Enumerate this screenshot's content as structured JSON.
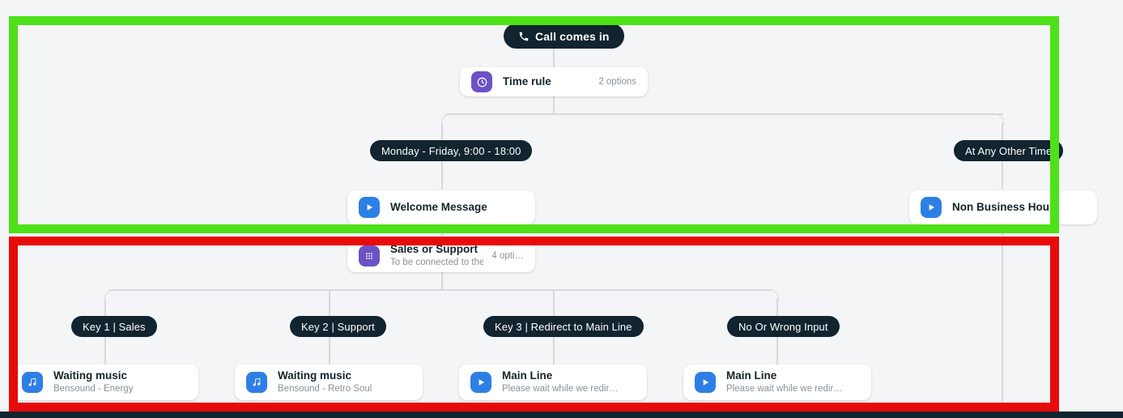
{
  "canvas": {
    "background": "#f4f5f6",
    "connector_color": "#d7d9dc"
  },
  "flow": {
    "start": {
      "label": "Call comes in",
      "icon": "phone-icon"
    },
    "time_rule": {
      "title": "Time rule",
      "meta": "2 options",
      "icon": "clock-icon",
      "icon_color": "#6d51c6"
    },
    "branches": [
      {
        "label": "Monday - Friday, 9:00 - 18:00"
      },
      {
        "label": "At Any Other Time"
      }
    ],
    "business_hours_card": {
      "title": "Welcome Message",
      "subtitle": "",
      "icon": "play-icon",
      "icon_color": "#2d7fe6"
    },
    "non_business_card": {
      "title": "Non Business Hours",
      "subtitle": "",
      "icon": "play-icon",
      "icon_color": "#2d7fe6"
    },
    "menu": {
      "title": "Sales or Support",
      "subtitle": "To be connected to the Sa…",
      "meta": "4 opti…",
      "icon": "keypad-icon",
      "icon_color": "#6d51c6"
    },
    "key_branches": [
      {
        "label": "Key 1 | Sales"
      },
      {
        "label": "Key 2 | Support"
      },
      {
        "label": "Key 3 | Redirect to Main Line"
      },
      {
        "label": "No Or Wrong Input"
      }
    ],
    "key_cards": [
      {
        "title": "Waiting music",
        "subtitle": "Bensound - Energy",
        "icon": "music-note-icon",
        "icon_color": "#2d7fe6"
      },
      {
        "title": "Waiting music",
        "subtitle": "Bensound - Retro Soul",
        "icon": "music-note-icon",
        "icon_color": "#2d7fe6"
      },
      {
        "title": "Main Line",
        "subtitle": "Please wait while we redir…",
        "icon": "play-icon",
        "icon_color": "#2d7fe6"
      },
      {
        "title": "Main Line",
        "subtitle": "Please wait while we redir…",
        "icon": "play-icon",
        "icon_color": "#2d7fe6"
      }
    ]
  },
  "annotations": {
    "green_box": {
      "color": "#4ee118"
    },
    "red_box": {
      "color": "#e80b0b"
    }
  }
}
